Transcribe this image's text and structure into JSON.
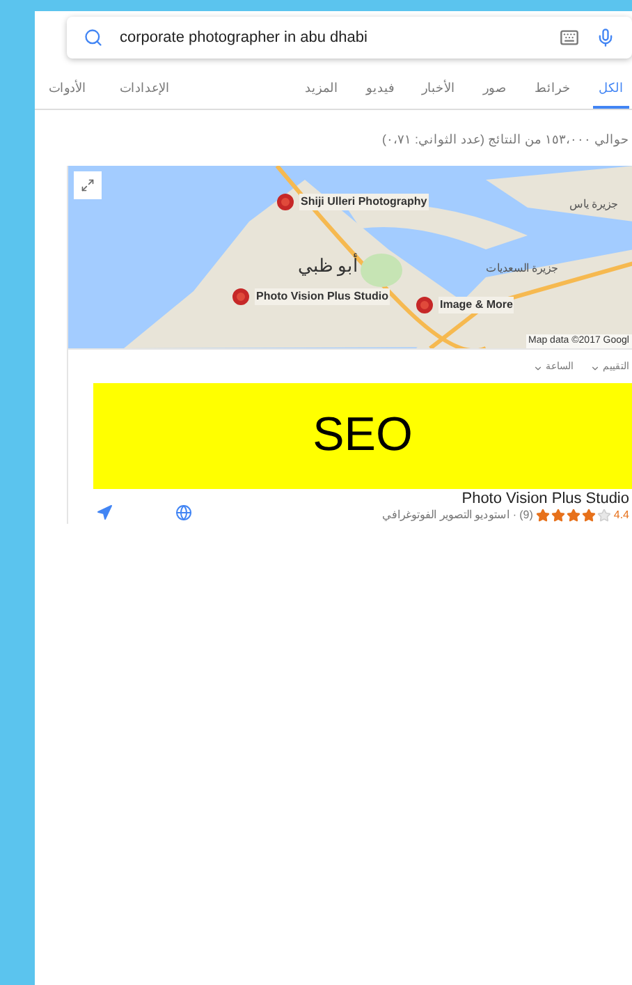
{
  "search": {
    "value": "corporate photographer in abu dhabi"
  },
  "tabs": [
    {
      "label": "الكل",
      "selected": true
    },
    {
      "label": "خرائط",
      "selected": false
    },
    {
      "label": "صور",
      "selected": false
    },
    {
      "label": "الأخبار",
      "selected": false
    },
    {
      "label": "فيديو",
      "selected": false
    },
    {
      "label": "المزيد",
      "selected": false
    }
  ],
  "tools": [
    "الإعدادات",
    "الأدوات"
  ],
  "result_stats": "حوالي ١٥٣،٠٠٠ من النتائج (عدد الثواني: ٠،٧١)",
  "map": {
    "labels": [
      {
        "text": "Shiji Ulleri Photography",
        "kind": "pin"
      },
      {
        "text": "أبو ظبي",
        "kind": "city"
      },
      {
        "text": "Photo Vision Plus Studio",
        "kind": "pin"
      },
      {
        "text": "Image & More",
        "kind": "pin"
      },
      {
        "text": "جزيرة ياس",
        "kind": "place"
      },
      {
        "text": "جزيرة السعديات",
        "kind": "place"
      }
    ],
    "attribution": "Map data ©2017 Googl"
  },
  "filters": [
    "التقييم",
    "الساعة"
  ],
  "banner": "SEO",
  "listing": {
    "name": "Photo Vision Plus Studio",
    "rating": "4.4",
    "stars": 4,
    "reviews": "(9)",
    "category": "· استوديو التصوير الفوتوغرافي"
  }
}
